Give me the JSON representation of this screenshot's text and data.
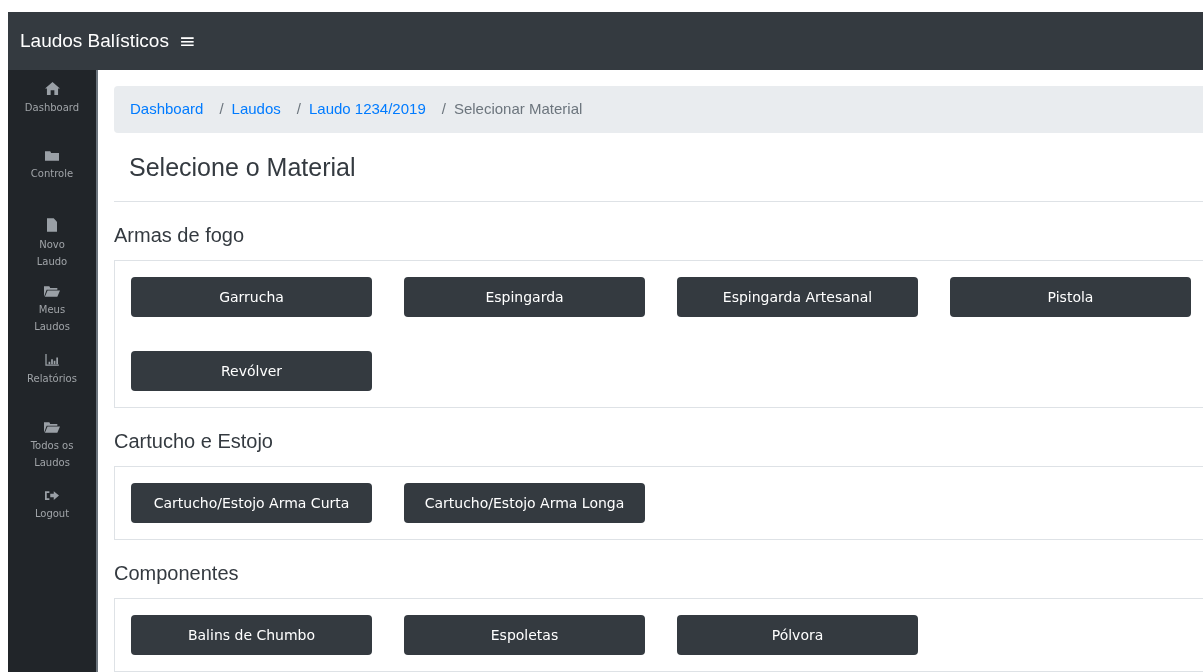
{
  "app": {
    "title": "Laudos Balísticos",
    "menu_glyph": "≡"
  },
  "sidebar": {
    "items": [
      {
        "label": "Dashboard"
      },
      {
        "label": "Controle"
      },
      {
        "label": "Novo Laudo"
      },
      {
        "label": "Meus Laudos"
      },
      {
        "label": "Relatórios"
      },
      {
        "label": "Todos os Laudos"
      },
      {
        "label": "Logout"
      }
    ]
  },
  "breadcrumb": [
    {
      "label": "Dashboard",
      "current": false
    },
    {
      "separator": "/",
      "label": "Laudos",
      "current": false
    },
    {
      "separator": "/",
      "label": "Laudo 1234/2019",
      "current": false
    },
    {
      "separator": "/",
      "label": "Selecionar Material",
      "current": true
    }
  ],
  "page_title": "Selecione o Material",
  "sections": [
    {
      "title": "Armas de fogo",
      "buttons": [
        "Garrucha",
        "Espingarda",
        "Espingarda Artesanal",
        "Pistola",
        "Revólver"
      ]
    },
    {
      "title": "Cartucho e Estojo",
      "buttons": [
        "Cartucho/Estojo Arma Curta",
        "Cartucho/Estojo Arma Longa"
      ]
    },
    {
      "title": "Componentes",
      "buttons": [
        "Balins de Chumbo",
        "Espoletas",
        "Pólvora"
      ]
    }
  ]
}
